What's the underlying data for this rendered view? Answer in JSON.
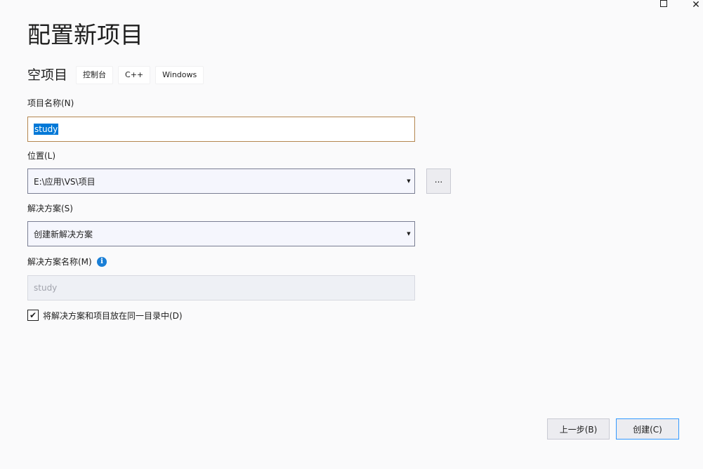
{
  "window": {
    "maximize_glyph": "□",
    "close_glyph": "✕"
  },
  "page": {
    "title": "配置新项目"
  },
  "template": {
    "name": "空项目",
    "tags": [
      "控制台",
      "C++",
      "Windows"
    ]
  },
  "project_name": {
    "label": "项目名称(N)",
    "value": "study"
  },
  "location": {
    "label": "位置(L)",
    "value": "E:\\应用\\VS\\项目",
    "browse_label": "..."
  },
  "solution": {
    "label": "解决方案(S)",
    "value": "创建新解决方案"
  },
  "solution_name": {
    "label": "解决方案名称(M)",
    "value": "study",
    "info_glyph": "i"
  },
  "same_directory": {
    "label": "将解决方案和项目放在同一目录中(D)",
    "checked": true,
    "check_glyph": "✔"
  },
  "footer": {
    "back_label": "上一步(B)",
    "create_label": "创建(C)"
  },
  "icons": {
    "dropdown": "▼"
  },
  "colors": {
    "background": "#fafafb",
    "selection": "#0078d7",
    "info": "#1a7fd6",
    "focus_border": "#3399ff",
    "name_border": "#b48650"
  }
}
